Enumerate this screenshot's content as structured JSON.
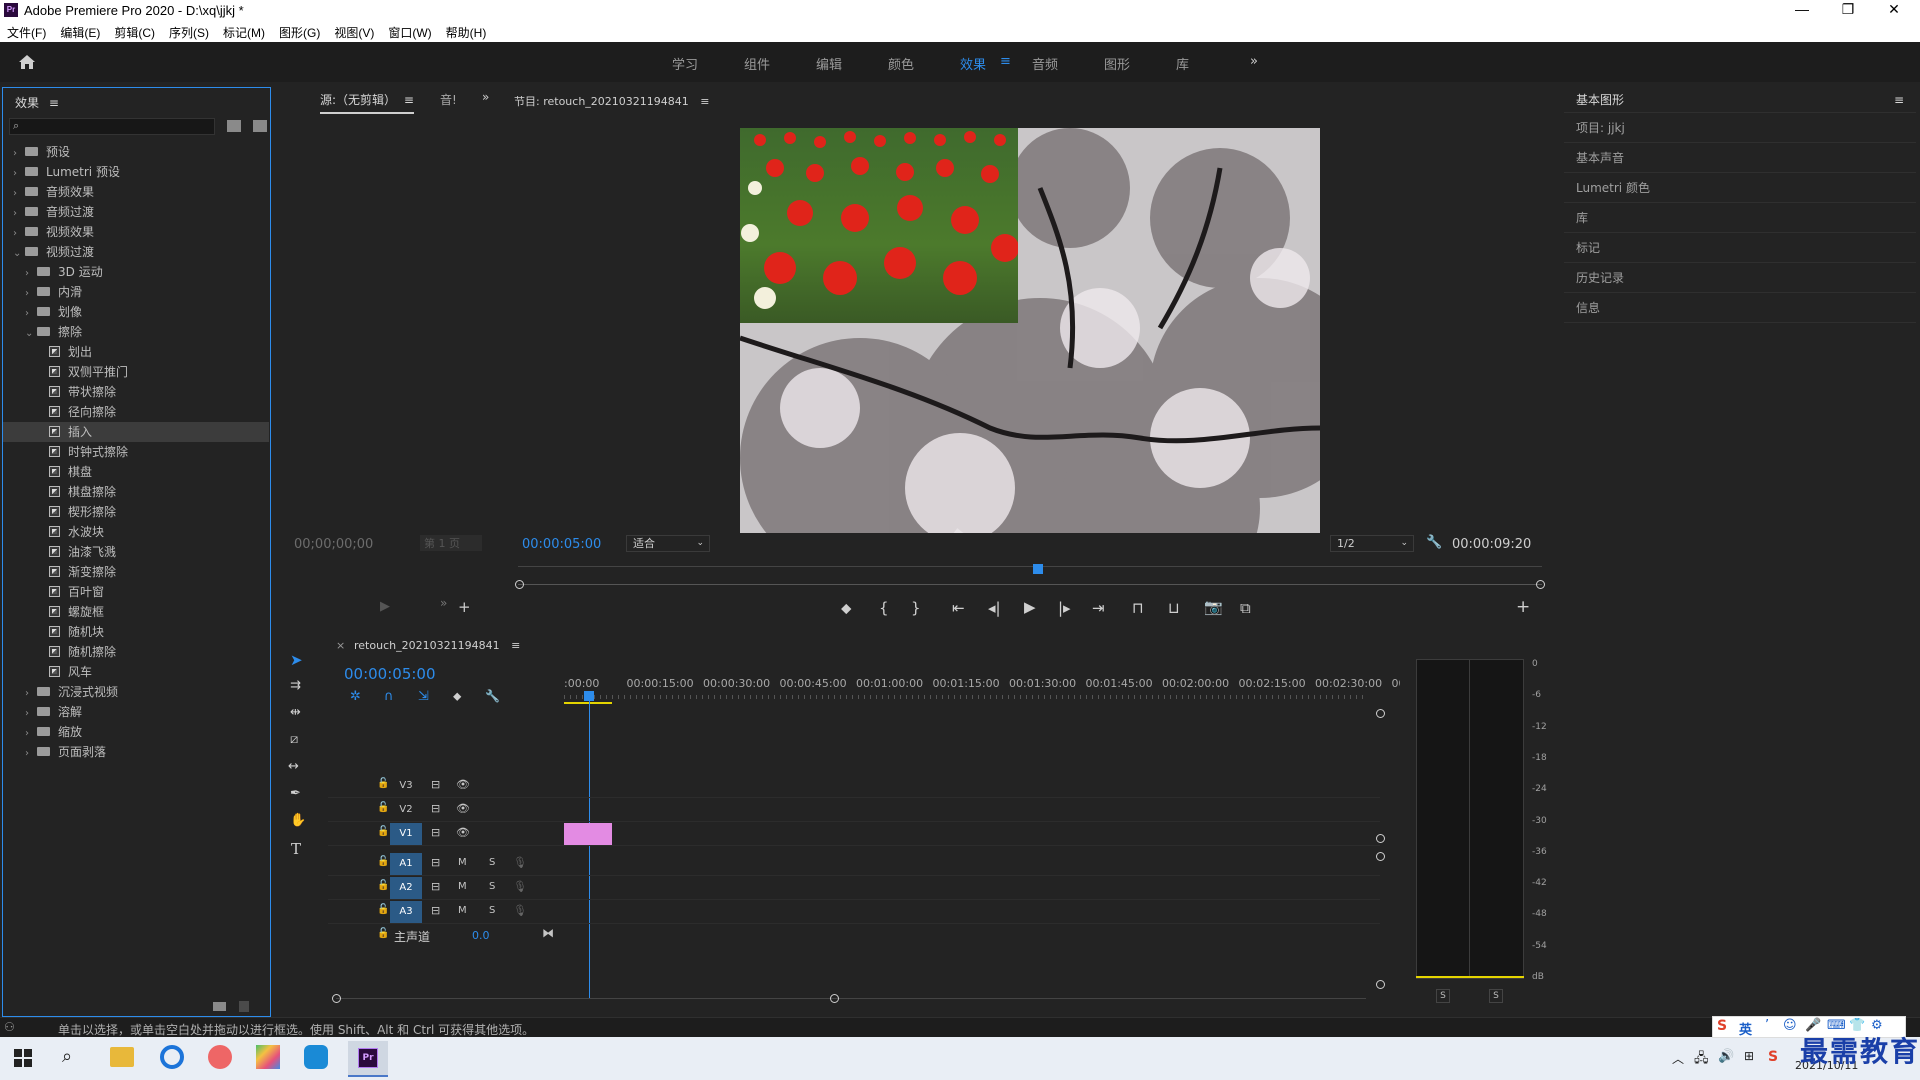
{
  "window": {
    "title": "Adobe Premiere Pro 2020 - D:\\xq\\jjkj *",
    "app_badge": "Pr",
    "minimize": "—",
    "maximize": "❐",
    "close": "✕"
  },
  "menu": [
    "文件(F)",
    "编辑(E)",
    "剪辑(C)",
    "序列(S)",
    "标记(M)",
    "图形(G)",
    "视图(V)",
    "窗口(W)",
    "帮助(H)"
  ],
  "workspaces": {
    "tabs": [
      "学习",
      "组件",
      "编辑",
      "颜色",
      "效果",
      "音频",
      "图形",
      "库"
    ],
    "active": "效果",
    "more": "»"
  },
  "effects_panel": {
    "title": "效果",
    "tree": [
      {
        "label": "预设",
        "type": "folder",
        "indent": 0,
        "arrow": "›"
      },
      {
        "label": "Lumetri 预设",
        "type": "folder",
        "indent": 0,
        "arrow": "›"
      },
      {
        "label": "音频效果",
        "type": "folder",
        "indent": 0,
        "arrow": "›"
      },
      {
        "label": "音频过渡",
        "type": "folder",
        "indent": 0,
        "arrow": "›"
      },
      {
        "label": "视频效果",
        "type": "folder",
        "indent": 0,
        "arrow": "›"
      },
      {
        "label": "视频过渡",
        "type": "folder",
        "indent": 0,
        "arrow": "⌄"
      },
      {
        "label": "3D 运动",
        "type": "folder",
        "indent": 1,
        "arrow": "›"
      },
      {
        "label": "内滑",
        "type": "folder",
        "indent": 1,
        "arrow": "›"
      },
      {
        "label": "划像",
        "type": "folder",
        "indent": 1,
        "arrow": "›"
      },
      {
        "label": "擦除",
        "type": "folder",
        "indent": 1,
        "arrow": "⌄"
      },
      {
        "label": "划出",
        "type": "fx",
        "indent": 2
      },
      {
        "label": "双侧平推门",
        "type": "fx",
        "indent": 2
      },
      {
        "label": "带状擦除",
        "type": "fx",
        "indent": 2
      },
      {
        "label": "径向擦除",
        "type": "fx",
        "indent": 2
      },
      {
        "label": "插入",
        "type": "fx",
        "indent": 2,
        "selected": true
      },
      {
        "label": "时钟式擦除",
        "type": "fx",
        "indent": 2
      },
      {
        "label": "棋盘",
        "type": "fx",
        "indent": 2
      },
      {
        "label": "棋盘擦除",
        "type": "fx",
        "indent": 2
      },
      {
        "label": "楔形擦除",
        "type": "fx",
        "indent": 2
      },
      {
        "label": "水波块",
        "type": "fx",
        "indent": 2
      },
      {
        "label": "油漆飞溅",
        "type": "fx",
        "indent": 2
      },
      {
        "label": "渐变擦除",
        "type": "fx",
        "indent": 2
      },
      {
        "label": "百叶窗",
        "type": "fx",
        "indent": 2
      },
      {
        "label": "螺旋框",
        "type": "fx",
        "indent": 2
      },
      {
        "label": "随机块",
        "type": "fx",
        "indent": 2
      },
      {
        "label": "随机擦除",
        "type": "fx",
        "indent": 2
      },
      {
        "label": "风车",
        "type": "fx",
        "indent": 2
      },
      {
        "label": "沉浸式视频",
        "type": "folder",
        "indent": 1,
        "arrow": "›"
      },
      {
        "label": "溶解",
        "type": "folder",
        "indent": 1,
        "arrow": "›"
      },
      {
        "label": "缩放",
        "type": "folder",
        "indent": 1,
        "arrow": "›"
      },
      {
        "label": "页面剥落",
        "type": "folder",
        "indent": 1,
        "arrow": "›"
      }
    ]
  },
  "source_monitor": {
    "tab": "源:（无剪辑）",
    "tab2": "音!",
    "timecode": "00;00;00;00",
    "page": "第 1 页"
  },
  "program_monitor": {
    "title": "节目: retouch_20210321194841",
    "timecode_in": "00:00:05:00",
    "fit": "适合",
    "resolution": "1/2",
    "duration": "00:00:09:20"
  },
  "timeline": {
    "sequence": "retouch_20210321194841",
    "timecode": "00:00:05:00",
    "ruler": [
      ":00:00",
      "00:00:15:00",
      "00:00:30:00",
      "00:00:45:00",
      "00:01:00:00",
      "00:01:15:00",
      "00:01:30:00",
      "00:01:45:00",
      "00:02:00:00",
      "00:02:15:00",
      "00:02:30:00",
      "00:"
    ],
    "video_tracks": [
      "V3",
      "V2",
      "V1"
    ],
    "audio_tracks": [
      "A1",
      "A2",
      "A3"
    ],
    "master": {
      "label": "主声道",
      "value": "0.0"
    },
    "mute": "M",
    "solo": "S"
  },
  "audio_meter": {
    "scale": [
      "0",
      "-6",
      "-12",
      "-18",
      "-24",
      "-30",
      "-36",
      "-42",
      "-48",
      "-54",
      "dB"
    ],
    "solo_left": "S",
    "solo_right": "S"
  },
  "right_panel": {
    "title": "基本图形",
    "items": [
      "项目: jjkj",
      "基本声音",
      "Lumetri 颜色",
      "库",
      "标记",
      "历史记录",
      "信息"
    ]
  },
  "status_bar": {
    "text": "单击以选择，或单击空白处并拖动以进行框选。使用 Shift、Alt 和 Ctrl 可获得其他选项。"
  },
  "taskbar": {
    "date": "2021/10/11",
    "ime": "英",
    "watermark": "最需教育"
  },
  "colors": {
    "accent": "#2d8ceb",
    "clip": "#e38be3",
    "track_on": "#2b5a86",
    "workspace_underline": "#2d8ceb"
  }
}
